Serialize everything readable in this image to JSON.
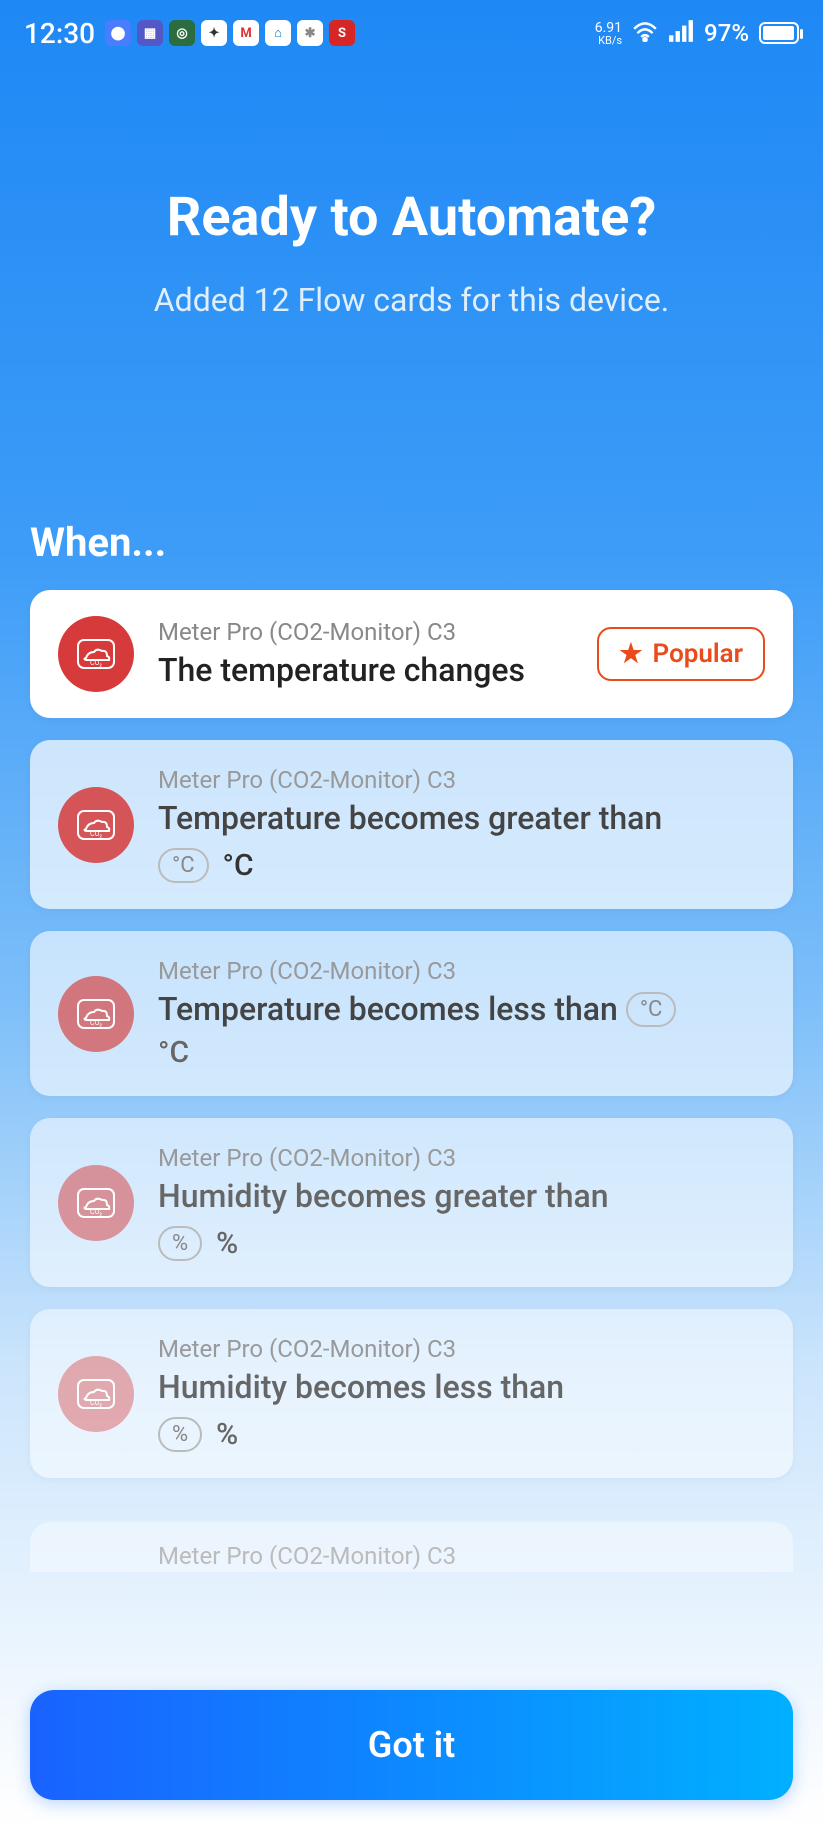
{
  "statusBar": {
    "time": "12:30",
    "netSpeed": "6.91",
    "netUnit": "KB/s",
    "battery": "97%"
  },
  "header": {
    "title": "Ready to Automate?",
    "subtitle": "Added 12 Flow cards for this device."
  },
  "section": {
    "heading": "When..."
  },
  "badge": {
    "popular": "Popular"
  },
  "cards": [
    {
      "device": "Meter Pro (CO2-Monitor) C3",
      "title": "The temperature changes"
    },
    {
      "device": "Meter Pro (CO2-Monitor) C3",
      "title": "Temperature becomes greater than",
      "chip": "°C",
      "unit": "°C"
    },
    {
      "device": "Meter Pro (CO2-Monitor) C3",
      "title": "Temperature becomes less than",
      "chip": "°C",
      "unit": "°C"
    },
    {
      "device": "Meter Pro (CO2-Monitor) C3",
      "title": "Humidity becomes greater than",
      "chip": "%",
      "unit": "%"
    },
    {
      "device": "Meter Pro (CO2-Monitor) C3",
      "title": "Humidity becomes less than",
      "chip": "%",
      "unit": "%"
    }
  ],
  "partial": {
    "device": "Meter Pro (CO2-Monitor) C3"
  },
  "button": {
    "gotIt": "Got it"
  }
}
